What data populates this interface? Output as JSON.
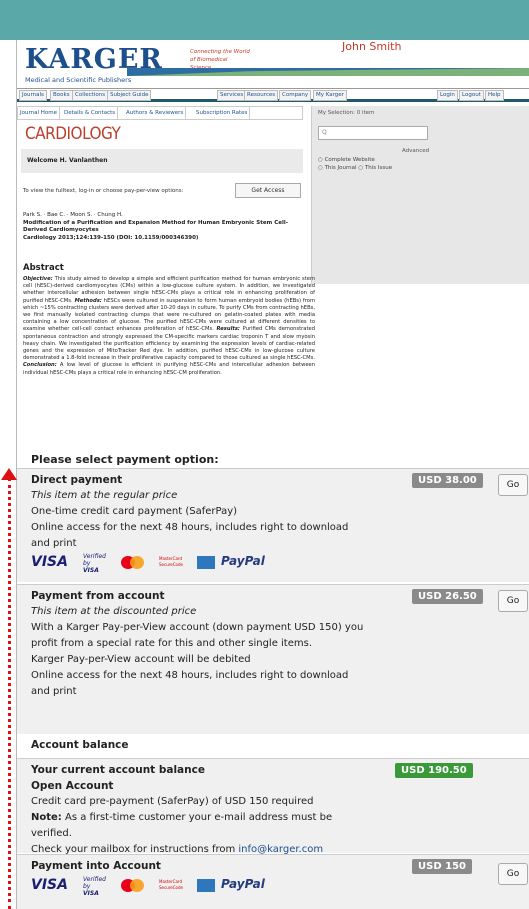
{
  "header": {
    "logo": "KARGER",
    "logo_sub": "Medical and Scientific Publishers",
    "tagline": "Connecting the World of Biomedical Science",
    "user_name": "John Smith"
  },
  "nav": {
    "left": [
      "Journals",
      "Books",
      "Collections",
      "Subject Guide"
    ],
    "right": [
      "Services",
      "Resources",
      "Company",
      "My Karger",
      "Login",
      "Logout",
      "Help"
    ]
  },
  "subnav": [
    "Journal Home",
    "Details & Contacts",
    "Authors & Reviewers",
    "Subscription Rates"
  ],
  "journal_title": "CARDIOLOGY",
  "welcome": "Welcome H. Vanlanthen",
  "fulltext_text": "To view the fulltext, log-in or choose pay-per-view options:",
  "get_access": "Get Access",
  "sidebar": {
    "selection": "My Selection: 0 item",
    "search_placeholder": "Q",
    "advanced": "Advanced",
    "radio1": "Complete Website",
    "radio2": "This Journal",
    "radio3": "This Issue"
  },
  "citation": {
    "authors": "Park S. · Bae C. · Moon S. · Chung H.",
    "title": "Modification of a Purification and Expansion Method for Human Embryonic Stem Cell-Derived Cardiomyocytes",
    "ref": "Cardiology 2013;124:139-150 (DOI: 10.1159/000346390)"
  },
  "abstract": {
    "heading": "Abstract",
    "label_objective": "Objective:",
    "objective": " This study aimed to develop a simple and efficient purification method for human embryonic stem cell (hESC)-derived cardiomyocytes (CMs) within a low-glucose culture system. In addition, we investigated whether intercellular adhesion between single hESC-CMs plays a critical role in enhancing proliferation of purified hESC-CMs.",
    "label_methods": "Methods:",
    "methods": " hESCs were cultured in suspension to form human embryoid bodies (hEBs) from which ~15% contracting clusters were derived after 10-20 days in culture. To purify CMs from contracting hEBs, we first manually isolated contracting clumps that were re-cultured on gelatin-coated plates with media containing a low concentration of glucose. The purified hESC-CMs were cultured at different densities to examine whether cell-cell contact enhances proliferation of hESC-CMs.",
    "label_results": "Results:",
    "results": " Purified CMs demonstrated spontaneous contraction and strongly expressed the CM-specific markers cardiac troponin T and slow myosin heavy chain. We investigated the purification efficiency by examining the expression levels of cardiac-related genes and the expression of MitoTracker Red dye. In addition, purified hESC-CMs in low-glucose culture demonstrated a 1.8-fold increase in their proliferative capacity compared to those cultured as single hESC-CMs.",
    "label_conclusion": "Conclusion:",
    "conclusion": " A low level of glucose is efficient in purifying hESC-CMs and intercellular adhesion between individual hESC-CMs plays a critical role in enhancing hESC-CM proliferation."
  },
  "payment": {
    "heading": "Please select payment option:",
    "direct": {
      "title": "Direct payment",
      "price": "USD 38.00",
      "line1": "This item at the regular price",
      "line2": "One-time credit card payment (SaferPay)",
      "line3": "Online access for the next 48 hours, includes right to download",
      "line4": "and print",
      "go": "Go"
    },
    "account": {
      "title": "Payment from account",
      "price": "USD 26.50",
      "line1": "This item at the discounted price",
      "line2": "With a Karger Pay-per-View account (down payment USD 150) you",
      "line3": "profit from a special rate for this and other single items.",
      "line4": "Karger Pay-per-View account will be debited",
      "line5": "Online access for the next 48 hours, includes right to download",
      "line6": "and print",
      "go": "Go"
    },
    "balance_heading": "Account balance",
    "balance": {
      "title": "Your current account balance",
      "amount": "USD 190.50",
      "open": "Open Account",
      "line1": "Credit card pre-payment (SaferPay) of USD 150 required",
      "note_label": "Note:",
      "line2": " As a first-time customer your e-mail address must be",
      "line3": "verified.",
      "line4": "Check your mailbox for instructions from ",
      "email": "info@karger.com"
    },
    "into": {
      "title": "Payment into Account",
      "price": "USD 150",
      "go": "Go"
    },
    "logos": {
      "visa": "VISA",
      "vbv1": "Verified by",
      "vbv2": "VISA",
      "ms": "MasterCard SecureCode",
      "paypal": "PayPal"
    }
  },
  "colors": {
    "topbar": "#5ba8a8",
    "brand": "#1d4f8c",
    "accent_red": "#c0392b",
    "price_grey": "#8a8a8a",
    "price_green": "#3a9a3a"
  }
}
